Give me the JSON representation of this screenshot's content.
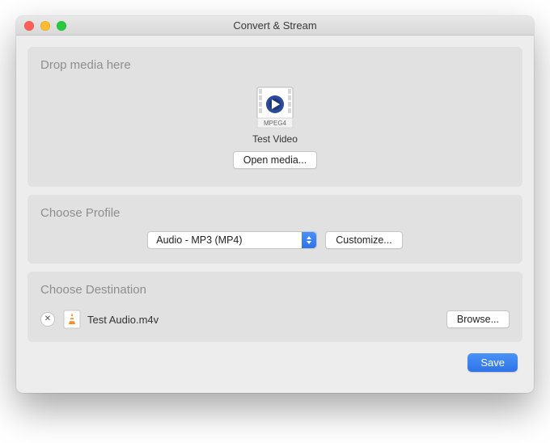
{
  "window": {
    "title": "Convert & Stream"
  },
  "drop": {
    "heading": "Drop media here",
    "file_label": "Test Video",
    "icon_badge": "MPEG4",
    "open_button": "Open media..."
  },
  "profile": {
    "heading": "Choose Profile",
    "selected": "Audio - MP3 (MP4)",
    "customize_button": "Customize..."
  },
  "destination": {
    "heading": "Choose Destination",
    "file_name": "Test Audio.m4v",
    "browse_button": "Browse..."
  },
  "footer": {
    "save_button": "Save"
  },
  "colors": {
    "accent": "#2f73e8"
  }
}
